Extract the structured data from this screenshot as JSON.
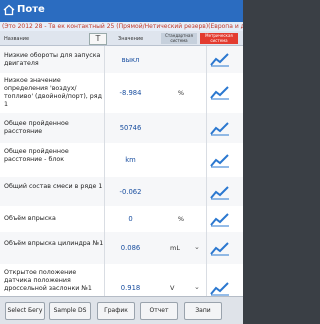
{
  "app": {
    "title": "Поте"
  },
  "banner": {
    "text": "(Это 2012 28 - Тв ек контактный 25 (Прямой/Нетический резерв)(Европа и другое)"
  },
  "header": {
    "col_name": "Название",
    "filter_label": "T",
    "col_value": "Значение",
    "btn_standard": "Стандартная система",
    "btn_metric": "Метрическая система"
  },
  "rows": [
    {
      "name": "Низкие обороты для запуска двигателя",
      "value": "выкл",
      "unit": "",
      "unit_select": false
    },
    {
      "name": "Низкое значение определения 'воздух/топливо' (двойной/порт), ряд 1",
      "value": "-8.984",
      "unit": "%",
      "unit_select": false
    },
    {
      "name": "Общее пройденное расстояние",
      "value": "50746",
      "unit": "",
      "unit_select": false
    },
    {
      "name": "Общее пройденное расстояние - блок",
      "value": "km",
      "unit": "",
      "unit_select": false
    },
    {
      "name": "Общий состав смеси в ряде 1",
      "value": "-0.062",
      "unit": "",
      "unit_select": false
    },
    {
      "name": "Объём впрыска",
      "value": "0",
      "unit": "%",
      "unit_select": false
    },
    {
      "name": "Объём впрыска цилиндра №1",
      "value": "0.086",
      "unit": "mL",
      "unit_select": true
    },
    {
      "name": "Открытое положение датчика положения дроссельной заслонки №1",
      "value": "0.918",
      "unit": "V",
      "unit_select": true
    }
  ],
  "bottom": {
    "select_label": "Select Бегу",
    "sample_label": "Sample DS",
    "graph_label": "График",
    "report_label": "Отчет",
    "extra_label": "Запи"
  },
  "colors": {
    "accent": "#2b6cc0",
    "metric": "#e33b2f",
    "value": "#1a4fa0"
  }
}
